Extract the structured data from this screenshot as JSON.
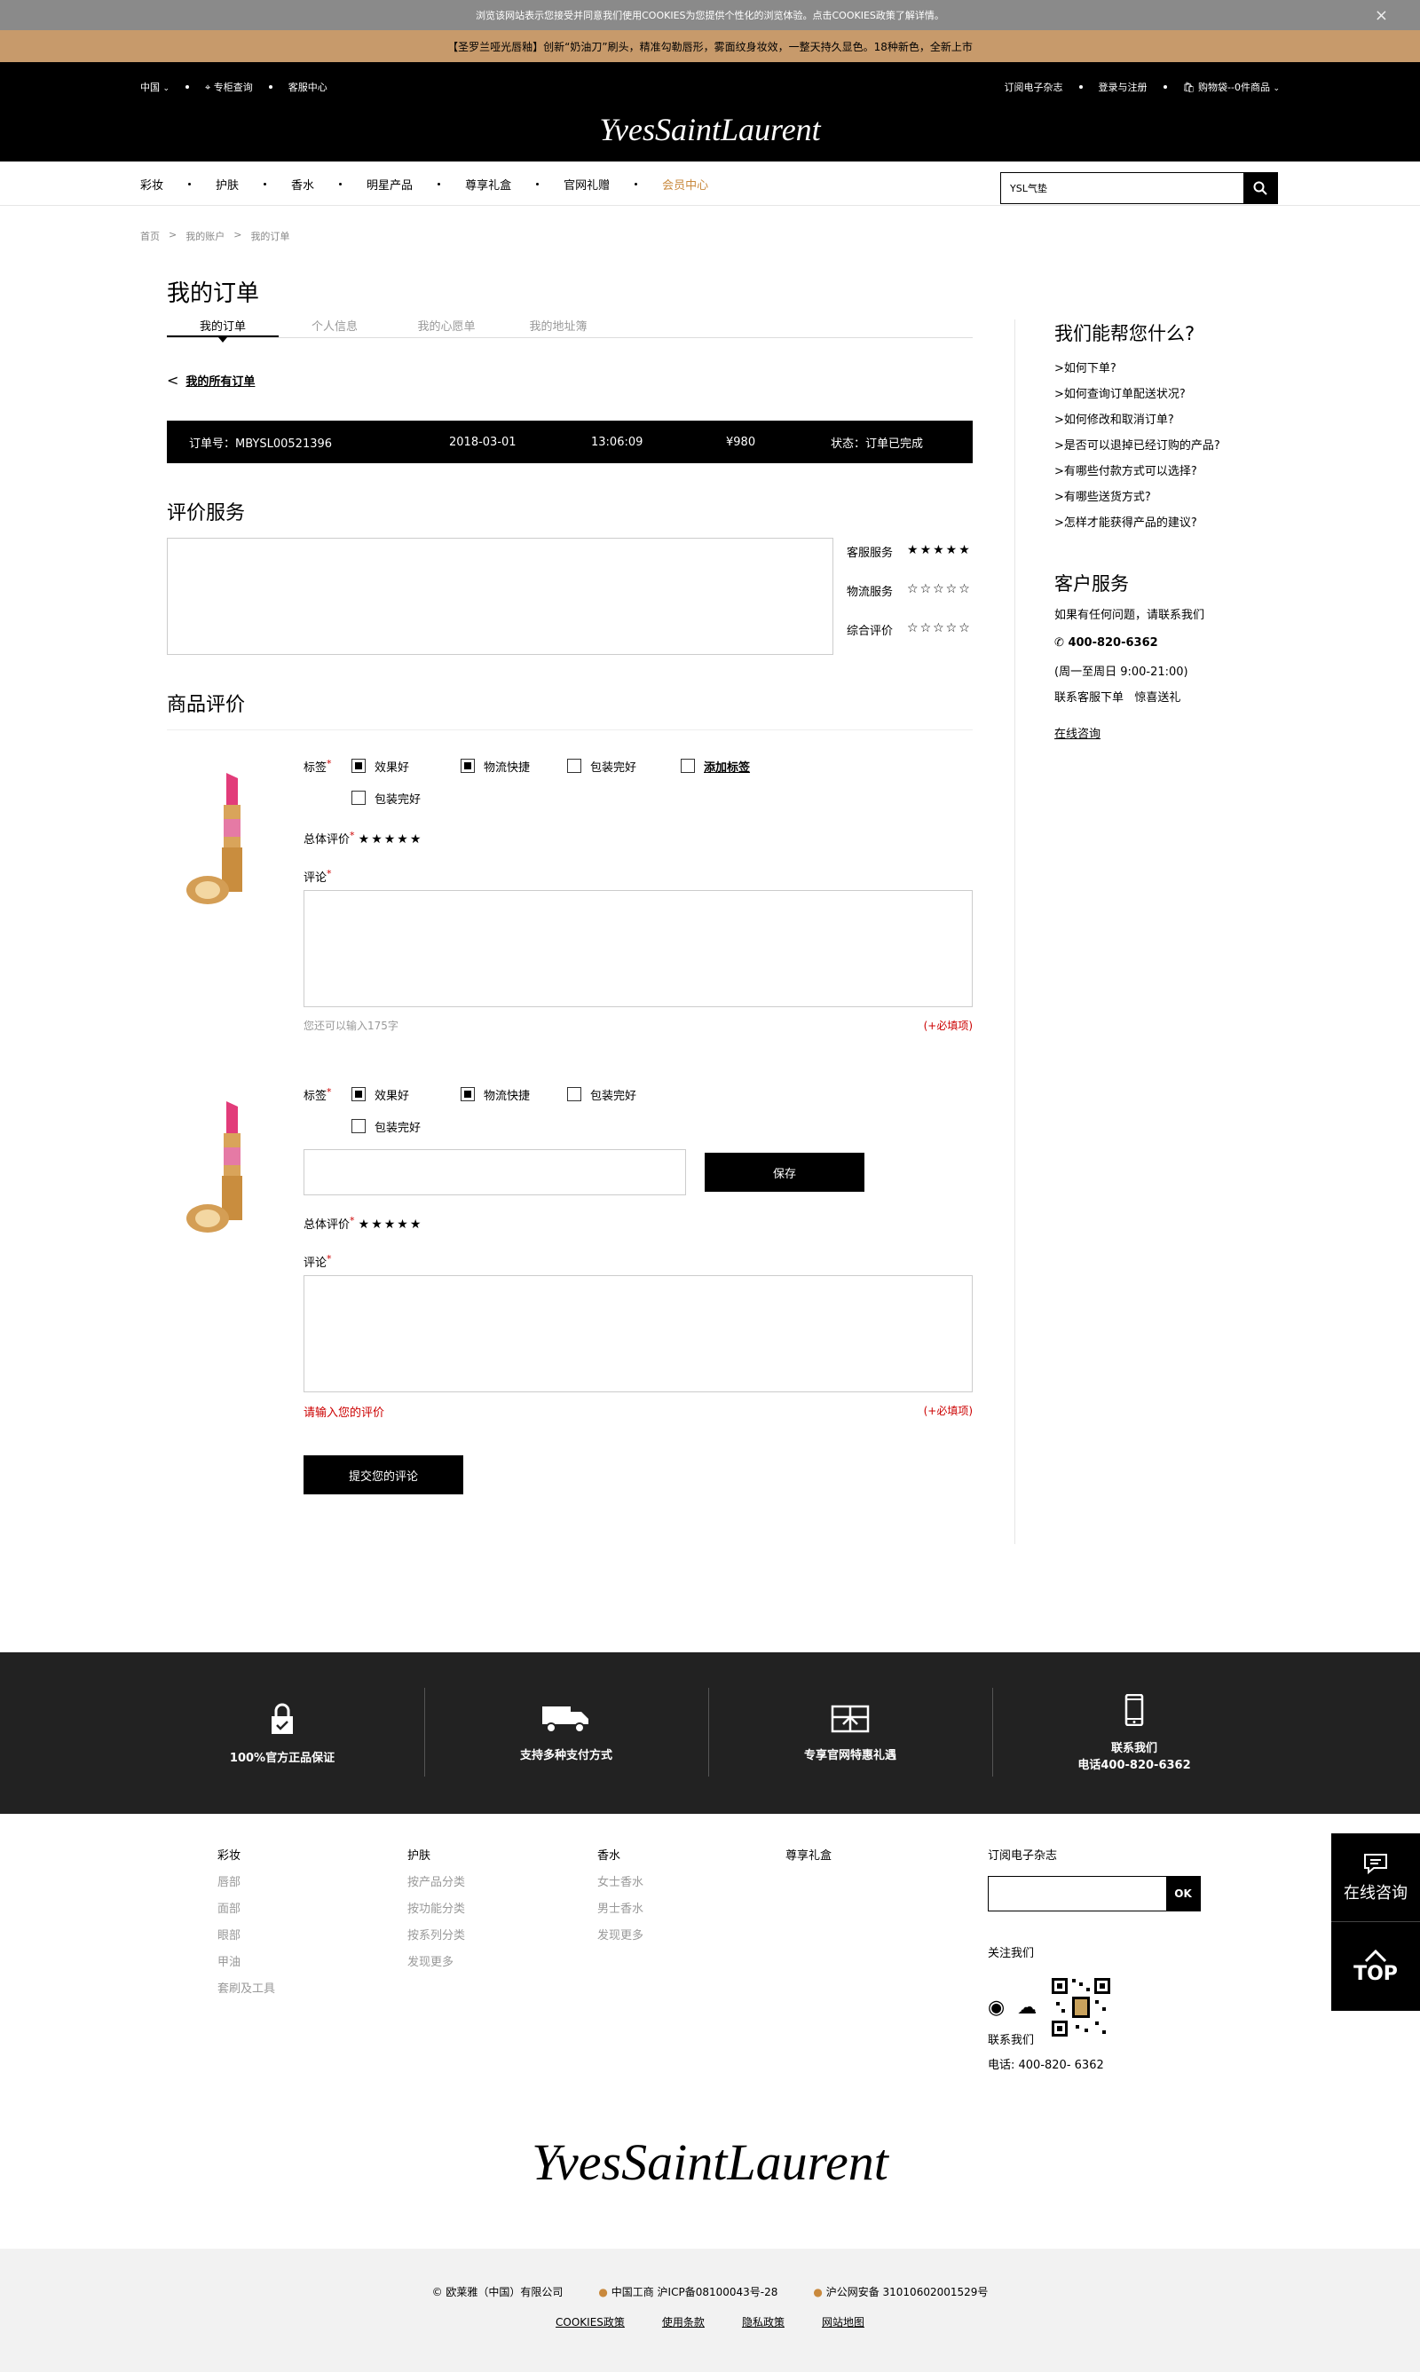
{
  "cookie_bar": {
    "text": "浏览该网站表示您接受并同意我们使用COOKIES为您提供个性化的浏览体验。点击COOKIES政策了解详情。",
    "close": "×"
  },
  "promo": {
    "text": "【圣罗兰哑光唇釉】创新“奶油刀”刷头，精准勾勒唇形，雾面纹身妆效，一整天持久显色。18种新色，全新上市"
  },
  "header": {
    "region": "中国",
    "store_locator": "专柜查询",
    "customer_center": "客服中心",
    "newsletter": "订阅电子杂志",
    "login": "登录与注册",
    "cart": "购物袋--0件商品",
    "logo": "YvesSaintLaurent"
  },
  "nav": {
    "items": [
      "彩妆",
      "护肤",
      "香水",
      "明星产品",
      "尊享礼盒",
      "官网礼赠",
      "会员中心"
    ],
    "search_value": "YSL气垫"
  },
  "breadcrumb": [
    "首页",
    "我的账户",
    "我的订单"
  ],
  "page": {
    "title": "我的订单",
    "tabs": [
      "我的订单",
      "个人信息",
      "我的心愿单",
      "我的地址簿"
    ],
    "back": "我的所有订单"
  },
  "order": {
    "number": "订单号：MBYSL00521396",
    "date": "2018-03-01",
    "time": "13:06:09",
    "amount": "¥980",
    "status": "状态：订单已完成"
  },
  "service_review": {
    "title": "评价服务",
    "ratings": [
      {
        "label": "客服服务",
        "stars": "★★★★★",
        "value": 5
      },
      {
        "label": "物流服务",
        "stars": "☆☆☆☆☆",
        "value": 0
      },
      {
        "label": "综合评价",
        "stars": "☆☆☆☆☆",
        "value": 0
      }
    ]
  },
  "product_review": {
    "title": "商品评价",
    "tag_label": "标签",
    "req": "*",
    "tags": [
      "效果好",
      "物流快捷",
      "包装完好",
      "添加标签",
      "包装完好"
    ],
    "overall_label": "总体评价",
    "overall_stars": "★★★★★",
    "comment_label": "评论",
    "remaining": "您还可以输入175字",
    "required_hint": "(+必填项)",
    "save": "保存",
    "error": "请输入您的评价",
    "submit": "提交您的评论"
  },
  "help": {
    "title": "我们能帮您什么?",
    "questions": [
      ">如何下单?",
      ">如何查询订单配送状况?",
      ">如何修改和取消订单?",
      ">是否可以退掉已经订购的产品?",
      ">有哪些付款方式可以选择?",
      ">有哪些送货方式?",
      ">怎样才能获得产品的建议?"
    ],
    "cs_title": "客户服务",
    "cs_desc": "如果有任何问题，请联系我们",
    "phone": "400-820-6362",
    "hours": "(周一至周日  9:00-21:00)",
    "contact": "联系客服下单",
    "gift": "惊喜送礼",
    "online": "在线咨询"
  },
  "features": [
    {
      "icon": "lock-icon",
      "text": "100%官方正品保证"
    },
    {
      "icon": "truck-icon",
      "text": "支持多种支付方式"
    },
    {
      "icon": "gift-icon",
      "text": "专享官网特惠礼遇"
    },
    {
      "icon": "phone-icon",
      "text": "联系我们",
      "text2": "电话400-820-6362"
    }
  ],
  "footer": {
    "cols": [
      {
        "head": "彩妆",
        "items": [
          "唇部",
          "面部",
          "眼部",
          "甲油",
          "套刷及工具"
        ]
      },
      {
        "head": "护肤",
        "items": [
          "按产品分类",
          "按功能分类",
          "按系列分类",
          "发现更多"
        ]
      },
      {
        "head": "香水",
        "items": [
          "女士香水",
          "男士香水",
          "发现更多"
        ]
      },
      {
        "head": "尊享礼盒",
        "items": []
      }
    ],
    "newsletter": "订阅电子杂志",
    "ok": "OK",
    "follow": "关注我们",
    "contact": "联系我们",
    "phone": "电话:  400-820- 6362",
    "copyright": "©  欧莱雅（中国）有限公司",
    "icp": "中国工商  沪ICP备08100043号-28",
    "police": "沪公网安备  31010602001529号",
    "links": [
      "COOKIES政策",
      "使用条款",
      "隐私政策",
      "网站地图"
    ]
  },
  "float": {
    "consult": "在线咨询",
    "top": "TOP"
  }
}
